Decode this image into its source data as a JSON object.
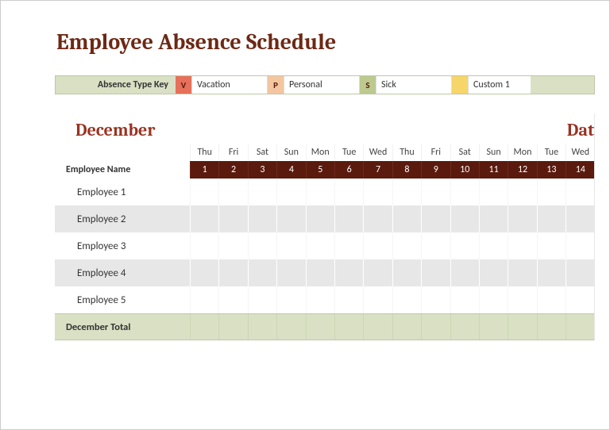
{
  "title": "Employee Absence Schedule",
  "legend": {
    "label": "Absence Type Key",
    "items": [
      {
        "code": "V",
        "name": "Vacation",
        "swatch_class": "sw-v",
        "text_class": "lt-v"
      },
      {
        "code": "P",
        "name": "Personal",
        "swatch_class": "sw-p",
        "text_class": "lt-p"
      },
      {
        "code": "S",
        "name": "Sick",
        "swatch_class": "sw-s",
        "text_class": "lt-s"
      },
      {
        "code": "",
        "name": "Custom 1",
        "swatch_class": "sw-c",
        "text_class": "lt-c"
      }
    ]
  },
  "month": {
    "name": "December",
    "right_label": "Dat",
    "employee_header": "Employee Name",
    "days": [
      {
        "abbr": "Thu",
        "num": "1"
      },
      {
        "abbr": "Fri",
        "num": "2"
      },
      {
        "abbr": "Sat",
        "num": "3"
      },
      {
        "abbr": "Sun",
        "num": "4"
      },
      {
        "abbr": "Mon",
        "num": "5"
      },
      {
        "abbr": "Tue",
        "num": "6"
      },
      {
        "abbr": "Wed",
        "num": "7"
      },
      {
        "abbr": "Thu",
        "num": "8"
      },
      {
        "abbr": "Fri",
        "num": "9"
      },
      {
        "abbr": "Sat",
        "num": "10"
      },
      {
        "abbr": "Sun",
        "num": "11"
      },
      {
        "abbr": "Mon",
        "num": "12"
      },
      {
        "abbr": "Tue",
        "num": "13"
      },
      {
        "abbr": "Wed",
        "num": "14"
      }
    ],
    "employees": [
      "Employee 1",
      "Employee 2",
      "Employee 3",
      "Employee 4",
      "Employee 5"
    ],
    "total_label": "December Total"
  },
  "chart_data": {
    "type": "table",
    "title": "Employee Absence Schedule — December",
    "columns": [
      "Employee Name",
      "1",
      "2",
      "3",
      "4",
      "5",
      "6",
      "7",
      "8",
      "9",
      "10",
      "11",
      "12",
      "13",
      "14"
    ],
    "rows": [
      [
        "Employee 1",
        "",
        "",
        "",
        "",
        "",
        "",
        "",
        "",
        "",
        "",
        "",
        "",
        "",
        ""
      ],
      [
        "Employee 2",
        "",
        "",
        "",
        "",
        "",
        "",
        "",
        "",
        "",
        "",
        "",
        "",
        "",
        ""
      ],
      [
        "Employee 3",
        "",
        "",
        "",
        "",
        "",
        "",
        "",
        "",
        "",
        "",
        "",
        "",
        "",
        ""
      ],
      [
        "Employee 4",
        "",
        "",
        "",
        "",
        "",
        "",
        "",
        "",
        "",
        "",
        "",
        "",
        "",
        ""
      ],
      [
        "Employee 5",
        "",
        "",
        "",
        "",
        "",
        "",
        "",
        "",
        "",
        "",
        "",
        "",
        "",
        ""
      ]
    ],
    "totals_row": [
      "December Total",
      "",
      "",
      "",
      "",
      "",
      "",
      "",
      "",
      "",
      "",
      "",
      "",
      "",
      ""
    ],
    "legend": {
      "V": "Vacation",
      "P": "Personal",
      "S": "Sick",
      "": "Custom 1"
    }
  }
}
